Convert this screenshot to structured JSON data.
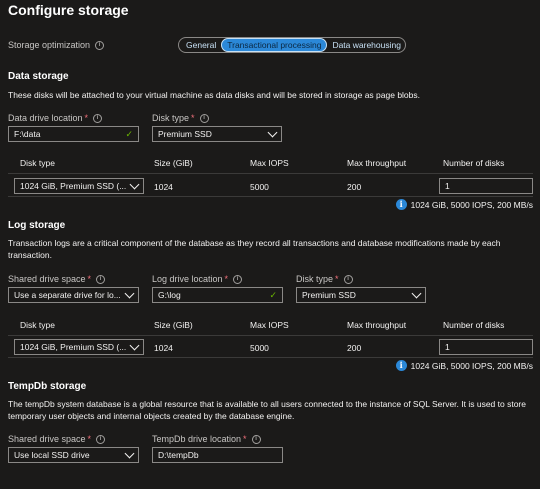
{
  "title": "Configure storage",
  "optimization": {
    "label": "Storage optimization",
    "options": [
      "General",
      "Transactional processing",
      "Data warehousing"
    ],
    "selected": "Transactional processing"
  },
  "data_storage": {
    "heading": "Data storage",
    "description": "These disks will be attached to your virtual machine as data disks and will be stored in storage as page blobs.",
    "location_label": "Data drive location",
    "location_value": "F:\\data",
    "disk_type_label": "Disk type",
    "disk_type_value": "Premium SSD",
    "columns": [
      "Disk type",
      "Size (GiB)",
      "Max IOPS",
      "Max throughput",
      "Number of disks"
    ],
    "row": {
      "disk_type": "1024 GiB, Premium SSD (...",
      "size": "1024",
      "iops": "5000",
      "throughput": "200",
      "count": "1"
    },
    "summary": "1024 GiB, 5000 IOPS, 200 MB/s"
  },
  "log_storage": {
    "heading": "Log storage",
    "description": "Transaction logs are a critical component of the database as they record all transactions and database modifications made by each transaction.",
    "shared_label": "Shared drive space",
    "shared_value": "Use a separate drive for lo...",
    "location_label": "Log drive location",
    "location_value": "G:\\log",
    "disk_type_label": "Disk type",
    "disk_type_value": "Premium SSD",
    "columns": [
      "Disk type",
      "Size (GiB)",
      "Max IOPS",
      "Max throughput",
      "Number of disks"
    ],
    "row": {
      "disk_type": "1024 GiB, Premium SSD (...",
      "size": "1024",
      "iops": "5000",
      "throughput": "200",
      "count": "1"
    },
    "summary": "1024 GiB, 5000 IOPS, 200 MB/s"
  },
  "tempdb_storage": {
    "heading": "TempDb storage",
    "description": "The tempDb system database is a global resource that is available to all users connected to the instance of SQL Server. It is used to store temporary user objects and internal objects created by the database engine.",
    "shared_label": "Shared drive space",
    "shared_value": "Use local SSD drive",
    "location_label": "TempDb drive location",
    "location_value": "D:\\tempDb"
  },
  "colors": {
    "background": "#1b1a19",
    "accent": "#2b88d8",
    "required": "#f1707b",
    "valid": "#6bb700"
  },
  "icons": {
    "info": "info-icon",
    "check": "check-icon",
    "dropdown": "chevron-down-icon",
    "summary": "info-filled-icon"
  }
}
